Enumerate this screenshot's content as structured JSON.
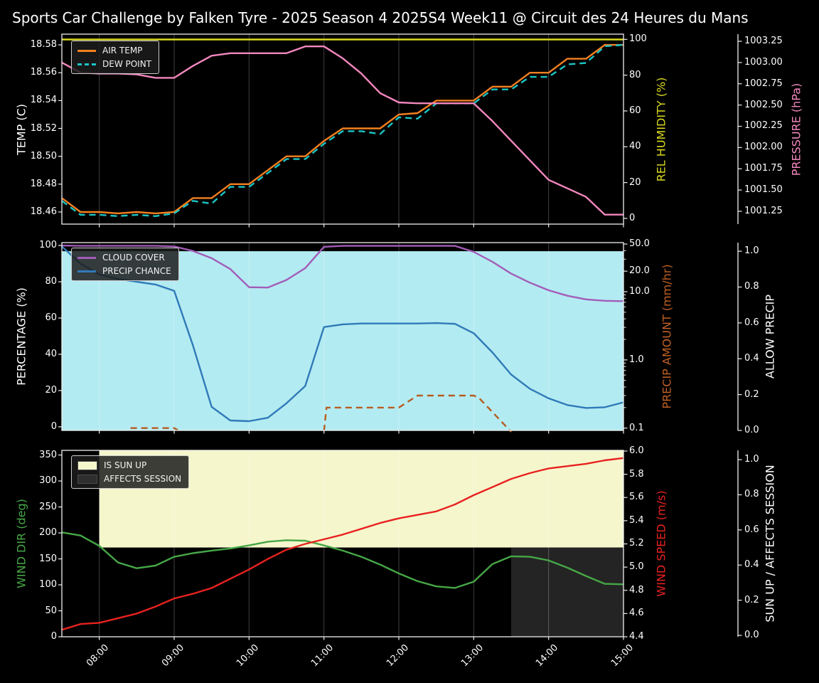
{
  "title": "Sports Car Challenge by Falken Tyre - 2025 Season 4 2025S4 Week11 @ Circuit des 24 Heures du Mans",
  "figure": {
    "background": "#000000",
    "time_domain": [
      "07:30",
      "15:00"
    ],
    "x_ticks": [
      "08:00",
      "09:00",
      "10:00",
      "11:00",
      "12:00",
      "13:00",
      "14:00",
      "15:00"
    ]
  },
  "chart_data": [
    {
      "type": "line",
      "id": "temp-humidity-pressure",
      "x": [
        "07:30",
        "07:45",
        "08:00",
        "08:15",
        "08:30",
        "08:45",
        "09:00",
        "09:15",
        "09:30",
        "09:45",
        "10:00",
        "10:15",
        "10:30",
        "10:45",
        "11:00",
        "11:15",
        "11:30",
        "11:45",
        "12:00",
        "12:15",
        "12:30",
        "12:45",
        "13:00",
        "13:15",
        "13:30",
        "13:45",
        "14:00",
        "14:15",
        "14:30",
        "14:45",
        "15:00"
      ],
      "axes": {
        "left": {
          "label": "TEMP (C)",
          "color": "#ffffff",
          "range": [
            18.4513,
            18.5877
          ],
          "ticks": [
            [
              18.46,
              "18.46"
            ],
            [
              18.48,
              "18.48"
            ],
            [
              18.5,
              "18.50"
            ],
            [
              18.52,
              "18.52"
            ],
            [
              18.54,
              "18.54"
            ],
            [
              18.56,
              "18.56"
            ],
            [
              18.58,
              "18.58"
            ]
          ]
        },
        "right1": {
          "label": "REL HUMIDITY (%)",
          "color": "#d9d91f",
          "range": [
            -3.2,
            102.9
          ],
          "ticks": [
            [
              0,
              "0"
            ],
            [
              20,
              "20"
            ],
            [
              40,
              "40"
            ],
            [
              60,
              "60"
            ],
            [
              80,
              "80"
            ],
            [
              100,
              "100"
            ]
          ]
        },
        "right2": {
          "label": "PRESSURE (hPa)",
          "color": "#f287be",
          "range": [
            1001.099,
            1003.334
          ],
          "ticks": [
            [
              1001.25,
              "1001.25"
            ],
            [
              1001.5,
              "1001.50"
            ],
            [
              1001.75,
              "1001.75"
            ],
            [
              1002.0,
              "1002.00"
            ],
            [
              1002.25,
              "1002.25"
            ],
            [
              1002.5,
              "1002.50"
            ],
            [
              1002.75,
              "1002.75"
            ],
            [
              1003.0,
              "1003.00"
            ],
            [
              1003.25,
              "1003.25"
            ]
          ]
        }
      },
      "series": [
        {
          "name": "AIR TEMP",
          "axis": "left",
          "color": "#f48020",
          "dashed": false,
          "values": [
            18.47,
            18.46,
            18.46,
            18.459,
            18.46,
            18.459,
            18.46,
            18.47,
            18.47,
            18.48,
            18.48,
            18.49,
            18.5,
            18.5,
            18.511,
            18.52,
            18.52,
            18.52,
            18.53,
            18.531,
            18.54,
            18.54,
            18.54,
            18.55,
            18.55,
            18.56,
            18.56,
            18.57,
            18.57,
            18.58,
            18.58
          ]
        },
        {
          "name": "DEW POINT",
          "axis": "left",
          "color": "#1cc5c5",
          "dashed": true,
          "values": [
            18.468,
            18.458,
            18.458,
            18.457,
            18.458,
            18.457,
            18.459,
            18.468,
            18.466,
            18.478,
            18.478,
            18.488,
            18.498,
            18.498,
            18.509,
            18.518,
            18.518,
            18.516,
            18.528,
            18.527,
            18.538,
            18.538,
            18.538,
            18.548,
            18.548,
            18.557,
            18.557,
            18.566,
            18.567,
            18.579,
            18.58
          ]
        },
        {
          "name": "REL HUMIDITY",
          "axis": "right1",
          "color": "#d9d91f",
          "dashed": false,
          "values": [
            99.9,
            99.9,
            99.9,
            99.9,
            99.9,
            99.9,
            99.9,
            99.9,
            99.9,
            99.9,
            99.9,
            99.9,
            99.9,
            99.9,
            99.9,
            99.9,
            99.9,
            99.9,
            99.9,
            99.9,
            99.9,
            99.9,
            99.9,
            99.9,
            99.9,
            99.9,
            99.9,
            99.9,
            99.9,
            99.9,
            99.9
          ]
        },
        {
          "name": "PRESSURE",
          "axis": "right2",
          "color": "#f287be",
          "dashed": false,
          "values": [
            1003.0,
            1002.88,
            1002.87,
            1002.87,
            1002.86,
            1002.82,
            1002.82,
            1002.96,
            1003.08,
            1003.11,
            1003.11,
            1003.11,
            1003.11,
            1003.19,
            1003.19,
            1003.05,
            1002.87,
            1002.64,
            1002.53,
            1002.52,
            1002.52,
            1002.52,
            1002.52,
            1002.31,
            1002.08,
            1001.85,
            1001.62,
            1001.52,
            1001.42,
            1001.21,
            1001.21
          ]
        }
      ],
      "legend": [
        {
          "label": "AIR TEMP",
          "swatch": "line",
          "color": "#f48020"
        },
        {
          "label": "DEW POINT",
          "swatch": "dash",
          "color": "#1cc5c5"
        }
      ]
    },
    {
      "type": "line",
      "id": "cloud-precip",
      "x": [
        "07:30",
        "07:45",
        "08:00",
        "08:15",
        "08:30",
        "08:45",
        "09:00",
        "09:15",
        "09:30",
        "09:45",
        "10:00",
        "10:15",
        "10:30",
        "10:45",
        "11:00",
        "11:15",
        "11:30",
        "11:45",
        "12:00",
        "12:15",
        "12:30",
        "12:45",
        "13:00",
        "13:15",
        "13:30",
        "13:45",
        "14:00",
        "14:15",
        "14:30",
        "14:45",
        "15:00"
      ],
      "axes": {
        "left": {
          "label": "PERCENTAGE (%)",
          "color": "#ffffff",
          "range": [
            -2.0,
            101.6
          ],
          "ticks": [
            [
              0,
              "0"
            ],
            [
              20,
              "20"
            ],
            [
              40,
              "40"
            ],
            [
              60,
              "60"
            ],
            [
              80,
              "80"
            ],
            [
              100,
              "100"
            ]
          ]
        },
        "right1": {
          "label": "PRECIP AMOUNT (mm/hr)",
          "color": "#c06024",
          "scale": "log",
          "range": [
            0.0924,
            52.5
          ],
          "ticks": [
            [
              0.1,
              "0.1"
            ],
            [
              1.0,
              "1.0"
            ],
            [
              10.0,
              "10.0"
            ],
            [
              20.0,
              "20.0"
            ],
            [
              50.0,
              "50.0"
            ]
          ],
          "minor_ticks": [
            0.2,
            0.3,
            0.4,
            0.5,
            0.6,
            0.7,
            0.8,
            0.9,
            2,
            3,
            4,
            5,
            6,
            7,
            8,
            9,
            30,
            40
          ]
        },
        "right2": {
          "label": "ALLOW PRECIP",
          "color": "#ffffff",
          "range": [
            0.0,
            1.048
          ],
          "ticks": [
            [
              0.0,
              "0.0"
            ],
            [
              0.2,
              "0.2"
            ],
            [
              0.4,
              "0.4"
            ],
            [
              0.6,
              "0.6"
            ],
            [
              0.8,
              "0.8"
            ],
            [
              1.0,
              "1.0"
            ]
          ]
        }
      },
      "fills": [
        {
          "name": "ALLOW PRECIP",
          "axis": "right2",
          "color": "#b3ebf2",
          "x_from": "07:30",
          "x_to": "15:00",
          "y_from": 0.0,
          "y_to": 1.0
        }
      ],
      "series": [
        {
          "name": "CLOUD COVER",
          "axis": "left",
          "color": "#a35cb8",
          "dashed": false,
          "values": [
            100,
            99.8,
            99.8,
            99.8,
            99.8,
            99.8,
            99.5,
            97,
            93,
            87,
            77,
            76.8,
            81,
            87.5,
            99.3,
            99.8,
            99.8,
            99.8,
            99.8,
            99.8,
            99.8,
            99.8,
            96.5,
            91,
            84.5,
            79.5,
            75.3,
            72.3,
            70.3,
            69.5,
            69.3
          ]
        },
        {
          "name": "PRECIP CHANCE",
          "axis": "left",
          "color": "#2f7ab8",
          "dashed": false,
          "values": [
            99.5,
            90,
            84,
            81.5,
            80,
            78.5,
            75,
            45,
            11,
            3.5,
            3.1,
            5,
            13,
            22.5,
            55,
            56.5,
            57,
            57,
            57,
            57,
            57.2,
            56.8,
            51.6,
            41,
            28.8,
            21,
            15.7,
            12,
            10.4,
            10.8,
            13.5
          ]
        },
        {
          "name": "PRECIP AMOUNT",
          "axis": "right1",
          "color": "#b65c20",
          "dashed": true,
          "points": [
            [
              "08:25",
              0.1
            ],
            [
              "09:00",
              0.1
            ],
            [
              "09:03",
              0.093
            ],
            null,
            [
              "11:00",
              0.09
            ],
            [
              "11:02",
              0.2
            ],
            [
              "12:00",
              0.2
            ],
            [
              "12:15",
              0.3
            ],
            [
              "13:00",
              0.3
            ],
            [
              "13:04",
              0.28
            ],
            [
              "13:30",
              0.088
            ]
          ]
        }
      ],
      "legend": [
        {
          "label": "CLOUD COVER",
          "swatch": "line",
          "color": "#a35cb8"
        },
        {
          "label": "PRECIP CHANCE",
          "swatch": "line",
          "color": "#2f7ab8"
        }
      ]
    },
    {
      "type": "line",
      "id": "wind-sun",
      "x": [
        "07:30",
        "07:45",
        "08:00",
        "08:15",
        "08:30",
        "08:45",
        "09:00",
        "09:15",
        "09:30",
        "09:45",
        "10:00",
        "10:15",
        "10:30",
        "10:45",
        "11:00",
        "11:15",
        "11:30",
        "11:45",
        "12:00",
        "12:15",
        "12:30",
        "12:45",
        "13:00",
        "13:15",
        "13:30",
        "13:45",
        "14:00",
        "14:15",
        "14:30",
        "14:45",
        "15:00"
      ],
      "axes": {
        "left": {
          "label": "WIND DIR (deg)",
          "color": "#46a746",
          "range": [
            0,
            359
          ],
          "ticks": [
            [
              0,
              "0"
            ],
            [
              50,
              "50"
            ],
            [
              100,
              "100"
            ],
            [
              150,
              "150"
            ],
            [
              200,
              "200"
            ],
            [
              250,
              "250"
            ],
            [
              300,
              "300"
            ],
            [
              350,
              "350"
            ]
          ]
        },
        "right1": {
          "label": "WIND SPEED (m/s)",
          "color": "#e8221f",
          "range": [
            4.4,
            6.006
          ],
          "ticks": [
            [
              4.4,
              "4.4"
            ],
            [
              4.6,
              "4.6"
            ],
            [
              4.8,
              "4.8"
            ],
            [
              5.0,
              "5.0"
            ],
            [
              5.2,
              "5.2"
            ],
            [
              5.4,
              "5.4"
            ],
            [
              5.6,
              "5.6"
            ],
            [
              5.8,
              "5.8"
            ],
            [
              6.0,
              "6.0"
            ]
          ]
        },
        "right2": {
          "label": "SUN UP / AFFECTS SESSION",
          "color": "#ffffff",
          "range": [
            -0.008,
            1.053
          ],
          "ticks": [
            [
              0.0,
              "0.0"
            ],
            [
              0.2,
              "0.2"
            ],
            [
              0.4,
              "0.4"
            ],
            [
              0.6,
              "0.6"
            ],
            [
              0.8,
              "0.8"
            ],
            [
              1.0,
              "1.0"
            ]
          ]
        }
      },
      "fills": [
        {
          "name": "IS SUN UP",
          "axis": "right2",
          "color": "#f6f6cd",
          "x_from": "08:00",
          "x_to": "15:00",
          "y_from": 0.5,
          "y_to": 1.053
        },
        {
          "name": "AFFECTS SESSION",
          "axis": "right2",
          "color": "#242424",
          "x_from": "13:30",
          "x_to": "15:00",
          "y_from": -0.008,
          "y_to": 0.5
        }
      ],
      "series": [
        {
          "name": "WIND DIR",
          "axis": "left",
          "color": "#46a746",
          "dashed": false,
          "values": [
            201,
            195,
            175,
            143,
            132,
            137,
            154,
            161,
            166,
            170,
            176,
            183,
            186,
            185,
            176,
            166,
            154,
            139,
            122,
            107,
            97,
            94,
            106,
            140,
            155,
            154,
            147,
            133,
            117,
            102,
            101
          ]
        },
        {
          "name": "WIND SPEED",
          "axis": "right1",
          "color": "#e8221f",
          "dashed": false,
          "values": [
            4.46,
            4.51,
            4.52,
            4.56,
            4.6,
            4.66,
            4.73,
            4.77,
            4.82,
            4.9,
            4.98,
            5.07,
            5.15,
            5.2,
            5.24,
            5.28,
            5.33,
            5.38,
            5.42,
            5.45,
            5.48,
            5.54,
            5.62,
            5.69,
            5.76,
            5.81,
            5.85,
            5.87,
            5.89,
            5.92,
            5.94
          ]
        }
      ],
      "legend": [
        {
          "label": "IS SUN UP",
          "swatch": "patch",
          "color": "#f6f6cd"
        },
        {
          "label": "AFFECTS SESSION",
          "swatch": "patch",
          "color": "#2e2e2e"
        }
      ]
    }
  ]
}
